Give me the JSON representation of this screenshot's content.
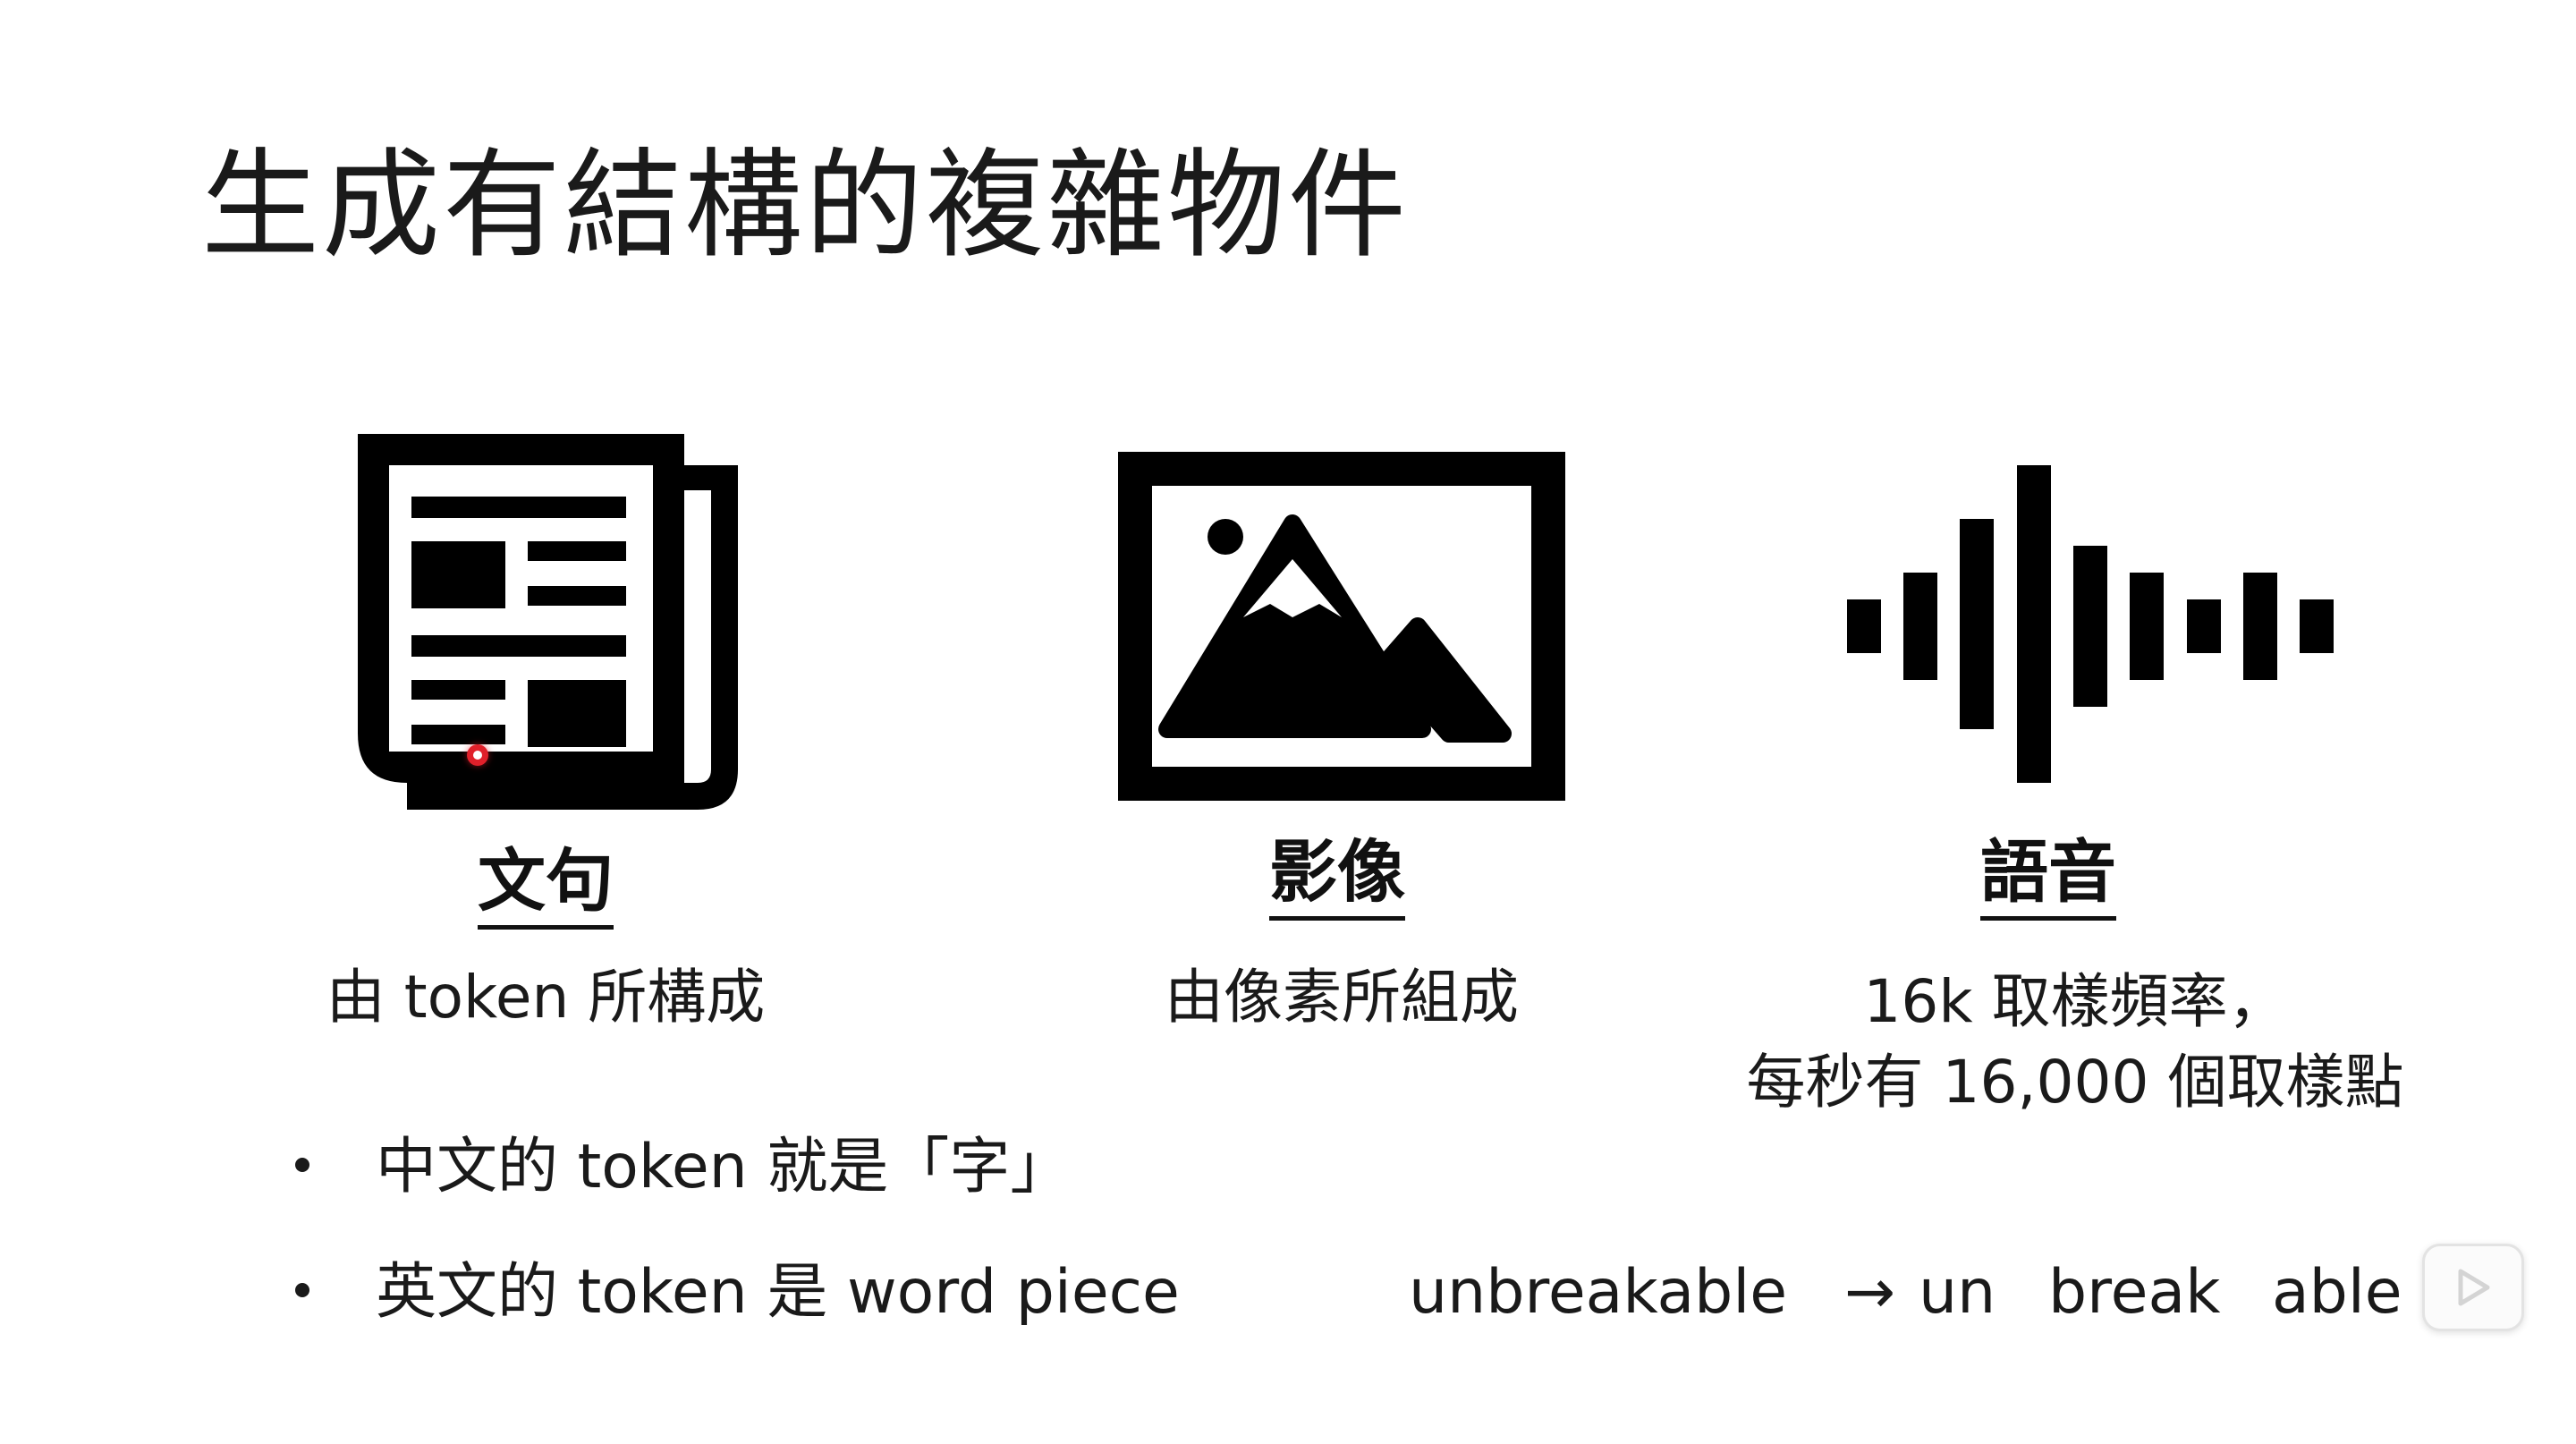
{
  "slide": {
    "title": "生成有結構的複雜物件",
    "items": [
      {
        "label": "文句",
        "desc_lines": [
          "由 token 所構成"
        ],
        "icon": "newspaper-icon"
      },
      {
        "label": "影像",
        "desc_lines": [
          "由像素所組成"
        ],
        "icon": "image-icon"
      },
      {
        "label": "語音",
        "desc_lines": [
          "16k 取樣頻率，",
          "每秒有 16,000 個取樣點"
        ],
        "icon": "sound-wave-icon"
      }
    ],
    "bullets": [
      "中文的 token 就是「字」",
      "英文的 token 是 word piece"
    ],
    "example": {
      "word": "unbreakable",
      "arrow": "→",
      "pieces": [
        "un",
        "break",
        "able"
      ]
    }
  },
  "colors": {
    "ink": "#000000",
    "text": "#1a1a1a",
    "cursor": "#e0202a"
  },
  "player": {
    "play_icon": "play-icon"
  }
}
